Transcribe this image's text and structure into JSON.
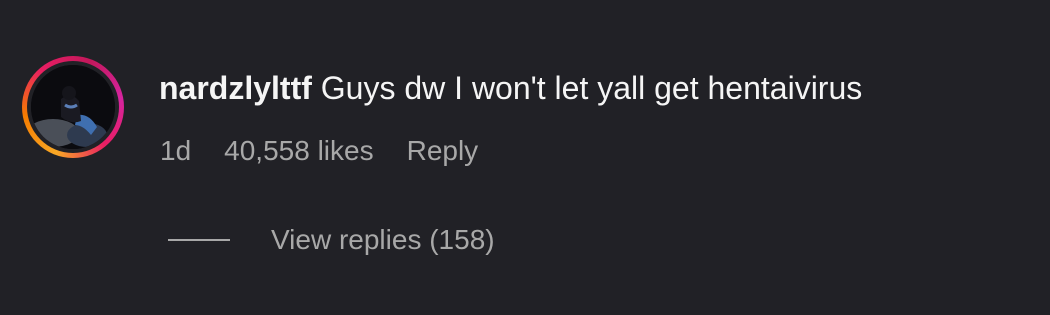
{
  "comment": {
    "username": "nardzlylttf",
    "text": "Guys dw I won't let yall get hentaivirus",
    "time": "1d",
    "likes": "40,558 likes",
    "reply_label": "Reply",
    "view_replies_label": "View replies (158)"
  },
  "colors": {
    "background": "#212126",
    "primary_text": "#f5f5f5",
    "secondary_text": "#a8a8a8",
    "story_ring": [
      "#f9a825",
      "#e91e63",
      "#d6249f"
    ]
  }
}
